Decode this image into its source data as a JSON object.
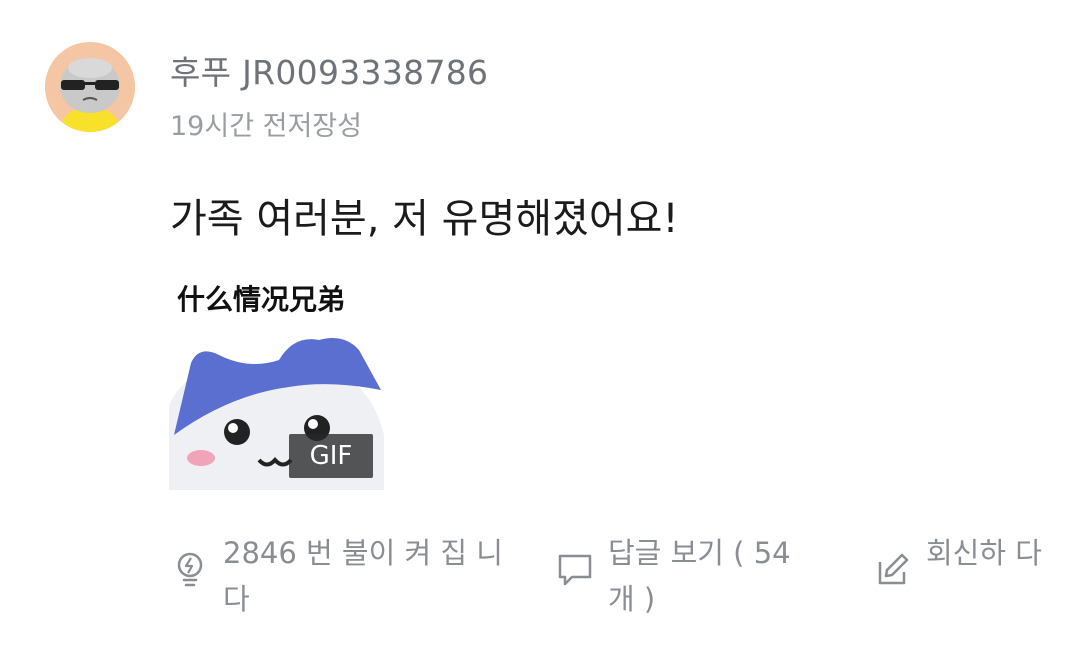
{
  "post": {
    "author": "후푸 JR0093338786",
    "timestamp": "19시간 전저장성",
    "text": "가족 여러분, 저 유명해졌어요!",
    "media": {
      "caption": "什么情况兄弟",
      "badge": "GIF"
    }
  },
  "actions": {
    "light_label": "2846 번 불이 켜 집 니다",
    "replies_label": "답글 보기 ( 54 개 )",
    "reply_label": "회신하 다"
  },
  "icons": {
    "light": "lightbulb-icon",
    "replies": "comment-icon",
    "reply": "edit-icon"
  },
  "colors": {
    "secondary_text": "#8a8e93",
    "avatar_bg": "#f4c6a3",
    "mascot_hat": "#5b6fd0"
  }
}
